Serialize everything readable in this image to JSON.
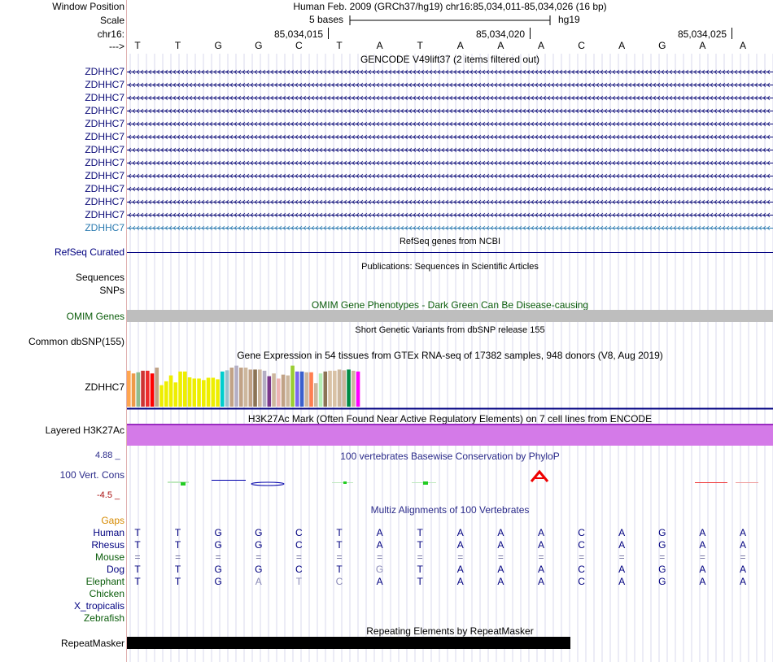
{
  "header": {
    "window_position_label": "Window Position",
    "scale_label": "Scale",
    "chrom_label": "chr16:",
    "strand_label": "--->",
    "assembly_title": "Human Feb. 2009 (GRCh37/hg19)   chr16:85,034,011-85,034,026 (16 bp)",
    "scale_text": "5 bases",
    "scale_db": "hg19",
    "coords": [
      "85,034,015",
      "85,034,020",
      "85,034,025"
    ]
  },
  "sequence": [
    "T",
    "T",
    "G",
    "G",
    "C",
    "T",
    "A",
    "T",
    "A",
    "A",
    "A",
    "C",
    "A",
    "G",
    "A",
    "A"
  ],
  "gencode": {
    "title": "GENCODE V49lift37 (2 items filtered out)",
    "labels": [
      "ZDHHC7",
      "ZDHHC7",
      "ZDHHC7",
      "ZDHHC7",
      "ZDHHC7",
      "ZDHHC7",
      "ZDHHC7",
      "ZDHHC7",
      "ZDHHC7",
      "ZDHHC7",
      "ZDHHC7",
      "ZDHHC7",
      "ZDHHC7"
    ],
    "colors": {
      "primary": "#0c0c78",
      "last": "#2a7ab0"
    }
  },
  "refseq": {
    "title": "RefSeq genes from NCBI",
    "label": "RefSeq Curated"
  },
  "publications": {
    "title": "Publications: Sequences in Scientific Articles",
    "label_sequences": "Sequences",
    "label_snps": "SNPs"
  },
  "omim": {
    "title": "OMIM Gene Phenotypes - Dark Green Can Be Disease-causing",
    "label": "OMIM Genes",
    "bar_color": "#bebebe"
  },
  "dbsnp": {
    "title": "Short Genetic Variants from dbSNP release 155",
    "label": "Common dbSNP(155)"
  },
  "gtex": {
    "title": "Gene Expression in 54 tissues from GTEx RNA-seq of 17382 samples, 948 donors (V8, Aug 2019)",
    "label": "ZDHHC7",
    "bars": [
      {
        "c": "#ffa54f",
        "v": 0.92
      },
      {
        "c": "#ee9a49",
        "v": 0.85
      },
      {
        "c": "#8fbc8f",
        "v": 0.88
      },
      {
        "c": "#cd3333",
        "v": 0.92
      },
      {
        "c": "#ee2c2c",
        "v": 0.92
      },
      {
        "c": "#ff0000",
        "v": 0.85
      },
      {
        "c": "#c1a286",
        "v": 1.0
      },
      {
        "c": "#eeee00",
        "v": 0.55
      },
      {
        "c": "#eeee00",
        "v": 0.65
      },
      {
        "c": "#eeee00",
        "v": 0.8
      },
      {
        "c": "#eeee00",
        "v": 0.62
      },
      {
        "c": "#eeee00",
        "v": 0.9
      },
      {
        "c": "#eeee00",
        "v": 0.9
      },
      {
        "c": "#eeee00",
        "v": 0.75
      },
      {
        "c": "#eeee00",
        "v": 0.72
      },
      {
        "c": "#eeee00",
        "v": 0.72
      },
      {
        "c": "#eeee00",
        "v": 0.68
      },
      {
        "c": "#eeee00",
        "v": 0.74
      },
      {
        "c": "#eeee00",
        "v": 0.74
      },
      {
        "c": "#eeee00",
        "v": 0.7
      },
      {
        "c": "#00cdcd",
        "v": 0.9
      },
      {
        "c": "#9ac0cd",
        "v": 0.93
      },
      {
        "c": "#c1a286",
        "v": 1.0
      },
      {
        "c": "#b4aec4",
        "v": 1.05
      },
      {
        "c": "#c1a286",
        "v": 1.0
      },
      {
        "c": "#cdb79e",
        "v": 1.0
      },
      {
        "c": "#c1a286",
        "v": 0.95
      },
      {
        "c": "#8b7355",
        "v": 0.95
      },
      {
        "c": "#cdb79e",
        "v": 0.95
      },
      {
        "c": "#b4aec4",
        "v": 0.92
      },
      {
        "c": "#7a378b",
        "v": 0.78
      },
      {
        "c": "#cdb79e",
        "v": 0.85
      },
      {
        "c": "#eeb4b4",
        "v": 0.72
      },
      {
        "c": "#c1a286",
        "v": 0.82
      },
      {
        "c": "#cdb79e",
        "v": 0.8
      },
      {
        "c": "#9acd32",
        "v": 1.05
      },
      {
        "c": "#7a67ee",
        "v": 0.9
      },
      {
        "c": "#3a5fcd",
        "v": 0.9
      },
      {
        "c": "#cdb79e",
        "v": 0.88
      },
      {
        "c": "#ff7f50",
        "v": 0.88
      },
      {
        "c": "#cdb79e",
        "v": 0.6
      },
      {
        "c": "#b4eeb4",
        "v": 0.85
      },
      {
        "c": "#8b7355",
        "v": 0.9
      },
      {
        "c": "#d9c2a6",
        "v": 0.92
      },
      {
        "c": "#d9c2a6",
        "v": 0.92
      },
      {
        "c": "#cdb79e",
        "v": 0.95
      },
      {
        "c": "#cdb79e",
        "v": 0.93
      },
      {
        "c": "#008b45",
        "v": 0.95
      },
      {
        "c": "#cdb79e",
        "v": 0.92
      },
      {
        "c": "#ff00ff",
        "v": 0.9
      }
    ]
  },
  "h3k27ac": {
    "title": "H3K27Ac Mark (Often Found Near Active Regulatory Elements) on 7 cell lines from ENCODE",
    "label": "Layered H3K27Ac",
    "fill": "#d47ae8",
    "line": "#9a2cc0"
  },
  "phylop": {
    "title": "100 vertebrates Basewise Conservation by PhyloP",
    "label": "100 Vert. Cons",
    "max": "4.88 _",
    "min": "-4.5 _"
  },
  "multiz": {
    "title": "Multiz Alignments of 100 Vertebrates",
    "gaps_label": "Gaps",
    "species": [
      {
        "name": "Human",
        "color": "#000080",
        "bases": [
          "T",
          "T",
          "G",
          "G",
          "C",
          "T",
          "A",
          "T",
          "A",
          "A",
          "A",
          "C",
          "A",
          "G",
          "A",
          "A"
        ]
      },
      {
        "name": "Rhesus",
        "color": "#000080",
        "bases": [
          "T",
          "T",
          "G",
          "G",
          "C",
          "T",
          "A",
          "T",
          "A",
          "A",
          "A",
          "C",
          "A",
          "G",
          "A",
          "A"
        ]
      },
      {
        "name": "Mouse",
        "color": "#0b5d0b",
        "bases": [
          "=",
          "=",
          "=",
          "=",
          "=",
          "=",
          "=",
          "=",
          "=",
          "=",
          "=",
          "=",
          "=",
          "=",
          "=",
          "="
        ]
      },
      {
        "name": "Dog",
        "color": "#000080",
        "bases": [
          "T",
          "T",
          "G",
          "G",
          "C",
          "T",
          "G",
          "T",
          "A",
          "A",
          "A",
          "C",
          "A",
          "G",
          "A",
          "A"
        ]
      },
      {
        "name": "Elephant",
        "color": "#0b5d0b",
        "bases": [
          "T",
          "T",
          "G",
          "A",
          "T",
          "C",
          "A",
          "T",
          "A",
          "A",
          "A",
          "C",
          "A",
          "G",
          "A",
          "A"
        ]
      },
      {
        "name": "Chicken",
        "color": "#0b5d0b",
        "bases": []
      },
      {
        "name": "X_tropicalis",
        "color": "#000080",
        "bases": []
      },
      {
        "name": "Zebrafish",
        "color": "#0b5d0b",
        "bases": []
      }
    ]
  },
  "repeatmasker": {
    "title": "Repeating Elements by RepeatMasker",
    "label": "RepeatMasker"
  }
}
